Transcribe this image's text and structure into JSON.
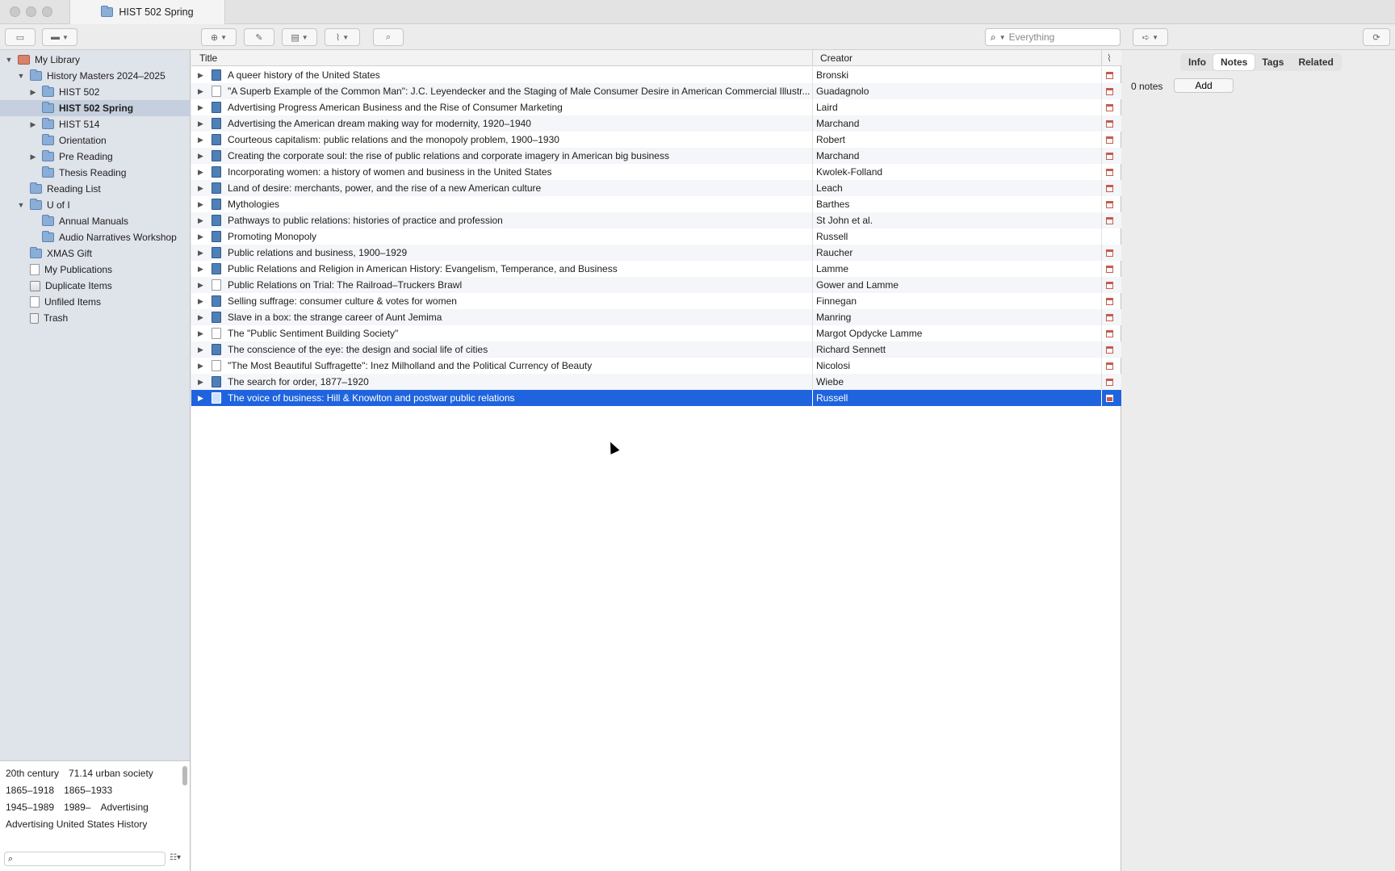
{
  "window": {
    "tab_title": "HIST 502 Spring"
  },
  "toolbar": {
    "search_placeholder": "Everything",
    "search_mode": "Everything"
  },
  "collections": [
    {
      "label": "My Library",
      "indent": 0,
      "twisty": "open",
      "icon": "library-icon"
    },
    {
      "label": "History Masters 2024–2025",
      "indent": 1,
      "twisty": "open",
      "icon": "folder-icon"
    },
    {
      "label": "HIST 502",
      "indent": 2,
      "twisty": "closed",
      "icon": "folder-icon"
    },
    {
      "label": "HIST 502 Spring",
      "indent": 2,
      "twisty": "none",
      "icon": "folder-icon",
      "selected": true
    },
    {
      "label": "HIST 514",
      "indent": 2,
      "twisty": "closed",
      "icon": "folder-icon"
    },
    {
      "label": "Orientation",
      "indent": 2,
      "twisty": "none",
      "icon": "folder-icon"
    },
    {
      "label": "Pre Reading",
      "indent": 2,
      "twisty": "closed",
      "icon": "folder-icon"
    },
    {
      "label": "Thesis Reading",
      "indent": 2,
      "twisty": "none",
      "icon": "folder-icon"
    },
    {
      "label": "Reading List",
      "indent": 1,
      "twisty": "none",
      "icon": "folder-icon"
    },
    {
      "label": "U of I",
      "indent": 1,
      "twisty": "open",
      "icon": "folder-icon"
    },
    {
      "label": "Annual Manuals",
      "indent": 2,
      "twisty": "none",
      "icon": "folder-icon"
    },
    {
      "label": "Audio Narratives Workshop",
      "indent": 2,
      "twisty": "none",
      "icon": "folder-icon"
    },
    {
      "label": "XMAS Gift",
      "indent": 1,
      "twisty": "none",
      "icon": "folder-icon"
    },
    {
      "label": "My Publications",
      "indent": 1,
      "twisty": "none",
      "icon": "document-icon"
    },
    {
      "label": "Duplicate Items",
      "indent": 1,
      "twisty": "none",
      "icon": "duplicate-icon"
    },
    {
      "label": "Unfiled Items",
      "indent": 1,
      "twisty": "none",
      "icon": "document-icon"
    },
    {
      "label": "Trash",
      "indent": 1,
      "twisty": "none",
      "icon": "trash-icon"
    }
  ],
  "tags": [
    [
      "20th century",
      "71.14 urban society"
    ],
    [
      "1865–1918",
      "1865–1933"
    ],
    [
      "1945–1989",
      "1989–",
      "Advertising"
    ],
    [
      "Advertising United States History"
    ]
  ],
  "items_header": {
    "title": "Title",
    "creator": "Creator"
  },
  "items": [
    {
      "title": "A queer history of the United States",
      "creator": "Bronski",
      "type": "book",
      "attachment": true
    },
    {
      "title": "\"A Superb Example of the Common Man\": J.C. Leyendecker and the Staging of Male Consumer Desire in American Commercial Illustr...",
      "creator": "Guadagnolo",
      "type": "article",
      "attachment": true
    },
    {
      "title": "Advertising Progress American Business and the Rise of Consumer Marketing",
      "creator": "Laird",
      "type": "book",
      "attachment": true
    },
    {
      "title": "Advertising the American dream making way for modernity, 1920–1940",
      "creator": "Marchand",
      "type": "book",
      "attachment": true
    },
    {
      "title": "Courteous capitalism: public relations and the monopoly problem, 1900–1930",
      "creator": "Robert",
      "type": "book",
      "attachment": true
    },
    {
      "title": "Creating the corporate soul: the rise of public relations and corporate imagery in American big business",
      "creator": "Marchand",
      "type": "book",
      "attachment": true
    },
    {
      "title": "Incorporating women: a history of women and business in the United States",
      "creator": "Kwolek-Folland",
      "type": "book",
      "attachment": true
    },
    {
      "title": "Land of desire: merchants, power, and the rise of a new American culture",
      "creator": "Leach",
      "type": "book",
      "attachment": true
    },
    {
      "title": "Mythologies",
      "creator": "Barthes",
      "type": "book",
      "attachment": true
    },
    {
      "title": "Pathways to public relations: histories of practice and profession",
      "creator": "St John et al.",
      "type": "book",
      "attachment": true
    },
    {
      "title": "Promoting Monopoly",
      "creator": "Russell",
      "type": "book",
      "attachment": false
    },
    {
      "title": "Public relations and business, 1900–1929",
      "creator": "Raucher",
      "type": "book",
      "attachment": true
    },
    {
      "title": "Public Relations and Religion in American History: Evangelism, Temperance, and Business",
      "creator": "Lamme",
      "type": "book",
      "attachment": true
    },
    {
      "title": "Public Relations on Trial: The Railroad–Truckers Brawl",
      "creator": "Gower and Lamme",
      "type": "article",
      "attachment": true
    },
    {
      "title": "Selling suffrage: consumer culture & votes for women",
      "creator": "Finnegan",
      "type": "book",
      "attachment": true
    },
    {
      "title": "Slave in a box: the strange career of Aunt Jemima",
      "creator": "Manring",
      "type": "book",
      "attachment": true
    },
    {
      "title": "The \"Public Sentiment Building Society\"",
      "creator": "Margot Opdycke Lamme",
      "type": "article",
      "attachment": true
    },
    {
      "title": "The conscience of the eye: the design and social life of cities",
      "creator": "Richard Sennett",
      "type": "book",
      "attachment": true
    },
    {
      "title": "\"The Most Beautiful Suffragette\": Inez Milholland and the Political Currency of Beauty",
      "creator": "Nicolosi",
      "type": "article",
      "attachment": true
    },
    {
      "title": "The search for order, 1877–1920",
      "creator": "Wiebe",
      "type": "book",
      "attachment": true
    },
    {
      "title": "The voice of business: Hill & Knowlton and postwar public relations",
      "creator": "Russell",
      "type": "book",
      "attachment": true,
      "selected": true
    }
  ],
  "item_pane": {
    "tabs": [
      "Info",
      "Notes",
      "Tags",
      "Related"
    ],
    "active_tab": "Notes",
    "notes_count": "0 notes",
    "add_label": "Add"
  }
}
